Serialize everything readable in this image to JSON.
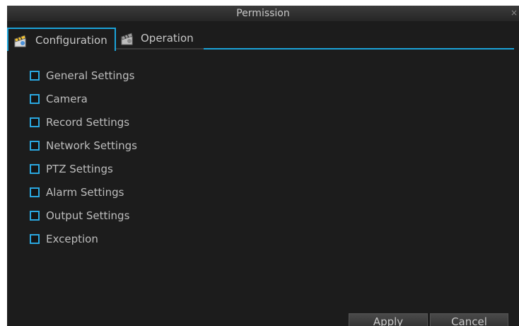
{
  "window": {
    "title": "Permission",
    "close_glyph": "×"
  },
  "tabs": [
    {
      "label": "Configuration",
      "icon": "clapperboard-icon",
      "active": true
    },
    {
      "label": "Operation",
      "icon": "clapperboard-icon",
      "active": false
    }
  ],
  "permissions": [
    {
      "label": "General Settings",
      "checked": false
    },
    {
      "label": "Camera",
      "checked": false
    },
    {
      "label": "Record Settings",
      "checked": false
    },
    {
      "label": "Network Settings",
      "checked": false
    },
    {
      "label": "PTZ Settings",
      "checked": false
    },
    {
      "label": "Alarm Settings",
      "checked": false
    },
    {
      "label": "Output Settings",
      "checked": false
    },
    {
      "label": "Exception",
      "checked": false
    }
  ],
  "buttons": {
    "apply": "Apply",
    "cancel": "Cancel"
  },
  "colors": {
    "accent": "#1ba3d9",
    "background": "#1c1c1c",
    "text": "#bdbdbd"
  }
}
